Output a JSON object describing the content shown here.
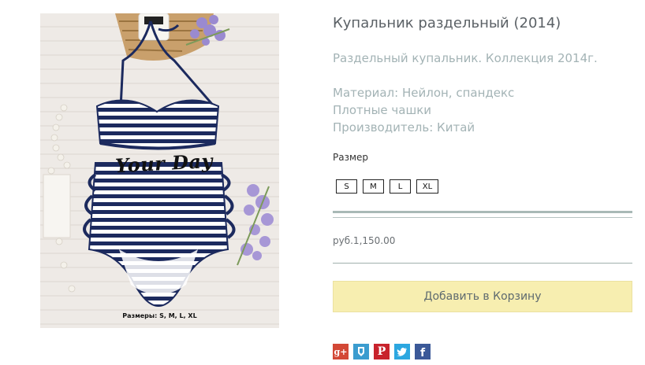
{
  "image": {
    "overlay_text": "Your Day",
    "caption": "Размеры: S, M, L, XL"
  },
  "product": {
    "title": "Купальник раздельный (2014)",
    "description_line1": "Раздельный купальник. Коллекция 2014г.",
    "material": "Материал: Нейлон, спандекс",
    "cups": "Плотные чашки",
    "manufacturer": "Производитель: Китай"
  },
  "size": {
    "label": "Размер",
    "options": [
      "S",
      "M",
      "L",
      "XL"
    ]
  },
  "price": "руб.1,150.00",
  "cart": {
    "button_label": "Добавить в Корзину"
  },
  "share": {
    "icons": [
      "google-plus-icon",
      "livejournal-icon",
      "pinterest-icon",
      "twitter-icon",
      "facebook-icon"
    ],
    "colors": {
      "google_plus": "#d34836",
      "livejournal": "#3b9ccf",
      "pinterest": "#c8232c",
      "twitter": "#2ca7e0",
      "facebook": "#3b5998"
    }
  },
  "colors": {
    "title": "#5b6166",
    "description": "#a3b3b5",
    "divider": "#a9b9b6",
    "cart_button_bg": "#f7eeb0",
    "cart_button_text": "#5e6a6f",
    "swimsuit_navy": "#1c2a5e"
  }
}
